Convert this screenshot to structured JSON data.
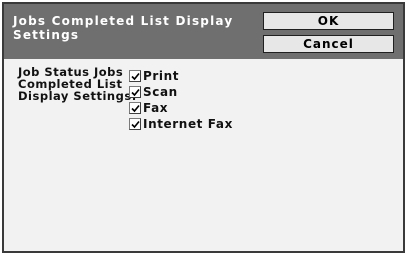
{
  "dialog": {
    "title": "Jobs Completed List Display Settings",
    "ok_label": "OK",
    "cancel_label": "Cancel"
  },
  "settings": {
    "label": "Job Status Jobs Completed List Display Settings:",
    "options": [
      {
        "label": "Print",
        "checked": true
      },
      {
        "label": "Scan",
        "checked": true
      },
      {
        "label": "Fax",
        "checked": true
      },
      {
        "label": "Internet Fax",
        "checked": true
      }
    ]
  },
  "colors": {
    "header_bg": "#6f6f6f",
    "body_bg": "#f2f2f2",
    "button_bg": "#e7e7e7"
  }
}
